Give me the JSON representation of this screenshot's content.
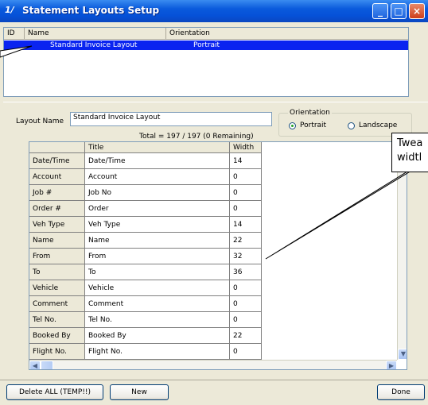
{
  "window": {
    "title": "Statement Layouts Setup"
  },
  "list": {
    "columns": [
      "ID",
      "Name",
      "Orientation"
    ],
    "selected_row": {
      "id": "",
      "name": "Standard Invoice Layout",
      "orientation": "Portrait"
    }
  },
  "form": {
    "layout_name_label": "Layout Name",
    "layout_name_value": "Standard Invoice Layout",
    "total_text": "Total = 197 / 197 (0 Remaining)",
    "orientation_label": "Orientation",
    "portrait_label": "Portrait",
    "landscape_label": "Landscape",
    "selected_orientation": "Portrait"
  },
  "grid": {
    "headers": [
      "",
      "Title",
      "Width"
    ],
    "rows": [
      {
        "field": "Date/Time",
        "title": "Date/Time",
        "width": "14"
      },
      {
        "field": "Account",
        "title": "Account",
        "width": "0"
      },
      {
        "field": "Job #",
        "title": "Job No",
        "width": "0"
      },
      {
        "field": "Order #",
        "title": "Order",
        "width": "0"
      },
      {
        "field": "Veh Type",
        "title": "Veh Type",
        "width": "14"
      },
      {
        "field": "Name",
        "title": "Name",
        "width": "22"
      },
      {
        "field": "From",
        "title": "From",
        "width": "32"
      },
      {
        "field": "To",
        "title": "To",
        "width": "36"
      },
      {
        "field": "Vehicle",
        "title": "Vehicle",
        "width": "0"
      },
      {
        "field": "Comment",
        "title": "Comment",
        "width": "0"
      },
      {
        "field": "Tel No.",
        "title": "Tel No.",
        "width": "0"
      },
      {
        "field": "Booked By",
        "title": "Booked By",
        "width": "22"
      },
      {
        "field": "Flight No.",
        "title": "Flight No.",
        "width": "0"
      }
    ]
  },
  "buttons": {
    "delete_all": "Delete ALL (TEMP!!)",
    "new": "New",
    "done": "Done"
  },
  "callout": {
    "text_line1": "Twea",
    "text_line2": "widtl"
  },
  "colors": {
    "title_bar": "#0a5adc",
    "selection": "#0a24f0"
  }
}
